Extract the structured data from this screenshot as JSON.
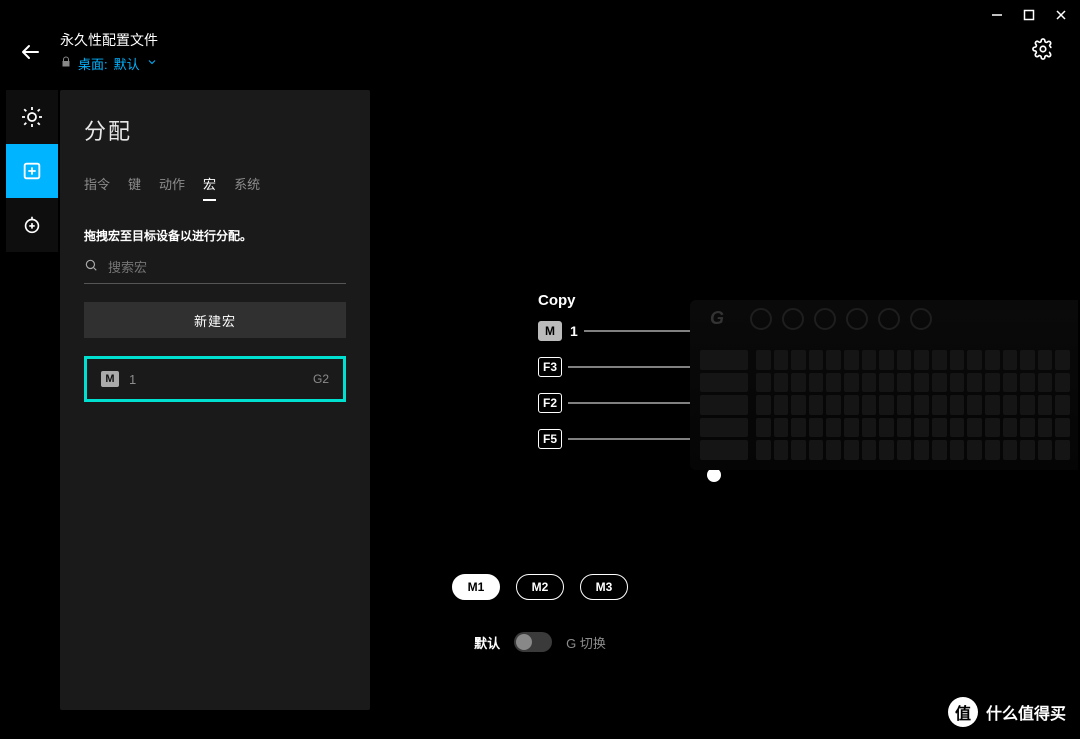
{
  "window_controls": {
    "minimize": "–",
    "maximize": "▭",
    "close": "✕"
  },
  "header": {
    "title": "永久性配置文件",
    "subtitle_prefix": "桌面:",
    "subtitle_value": "默认"
  },
  "sidenav": {
    "items": [
      {
        "name": "brightness",
        "active": false
      },
      {
        "name": "assignments",
        "active": true
      },
      {
        "name": "game-mode",
        "active": false
      }
    ]
  },
  "panel": {
    "title": "分配",
    "tabs": [
      "指令",
      "键",
      "动作",
      "宏",
      "系统"
    ],
    "active_tab_index": 3,
    "hint": "拖拽宏至目标设备以进行分配。",
    "search_placeholder": "搜索宏",
    "new_macro_label": "新建宏",
    "macros": [
      {
        "tag": "M",
        "label": "1",
        "key": "G2",
        "selected": true
      }
    ]
  },
  "stage": {
    "callout_title": "Copy",
    "callouts": [
      {
        "badge": "M",
        "filled": true,
        "label": "1"
      },
      {
        "badge": "F3",
        "filled": false,
        "label": ""
      },
      {
        "badge": "F2",
        "filled": false,
        "label": ""
      },
      {
        "badge": "F5",
        "filled": false,
        "label": ""
      }
    ]
  },
  "m_pills": {
    "options": [
      "M1",
      "M2",
      "M3"
    ],
    "active_index": 0
  },
  "toggle": {
    "left": "默认",
    "right": "G 切换",
    "state": "left"
  },
  "watermark": {
    "icon": "值",
    "text": "什么值得买"
  }
}
